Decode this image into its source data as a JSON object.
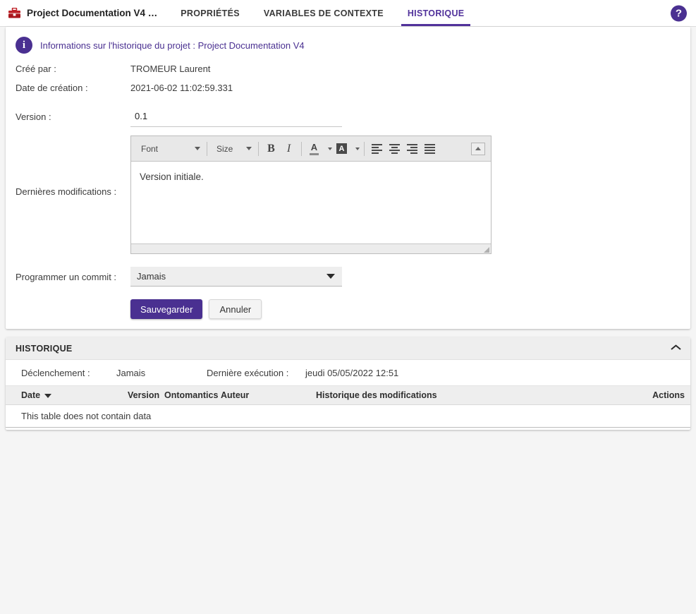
{
  "topbar": {
    "project_icon": "toolbox-icon",
    "project_title": "Project Documentation V4 …",
    "tabs": [
      {
        "label": "PROPRIÉTÉS",
        "active": false
      },
      {
        "label": "VARIABLES DE CONTEXTE",
        "active": false
      },
      {
        "label": "HISTORIQUE",
        "active": true
      }
    ],
    "help_icon": "?",
    "accent_color": "#4a3091"
  },
  "info_banner": {
    "icon": "info-icon",
    "text": "Informations sur l'historique du projet : Project Documentation V4"
  },
  "form": {
    "created_by_label": "Créé par :",
    "created_by_value": "TROMEUR Laurent",
    "creation_date_label": "Date de création :",
    "creation_date_value": "2021-06-02 11:02:59.331",
    "version_label": "Version :",
    "version_value": "0.1",
    "last_changes_label": "Dernières modifications :",
    "last_changes_value": "Version initiale.",
    "commit_label": "Programmer un commit :",
    "commit_value": "Jamais",
    "save_label": "Sauvegarder",
    "cancel_label": "Annuler"
  },
  "editor_toolbar": {
    "font_label": "Font",
    "size_label": "Size",
    "bold_glyph": "B",
    "italic_glyph": "I",
    "text_color_glyph": "A",
    "bg_color_glyph": "A",
    "buttons": [
      "font-dropdown",
      "size-dropdown",
      "bold-button",
      "italic-button",
      "text-color-button",
      "background-color-button",
      "align-left-button",
      "align-center-button",
      "align-right-button",
      "align-justify-button",
      "collapse-toolbar-button"
    ]
  },
  "history_panel": {
    "title": "HISTORIQUE",
    "collapsed": false,
    "trigger_label": "Déclenchement :",
    "trigger_value": "Jamais",
    "last_run_label": "Dernière exécution :",
    "last_run_value": "jeudi 05/05/2022 12:51",
    "table": {
      "columns": [
        "Date",
        "Version",
        "Ontomantics",
        "Auteur",
        "Historique des modifications",
        "Actions"
      ],
      "sorted_column": "Date",
      "sort_direction": "desc",
      "rows": [],
      "empty_message": "This table does not contain data"
    }
  }
}
